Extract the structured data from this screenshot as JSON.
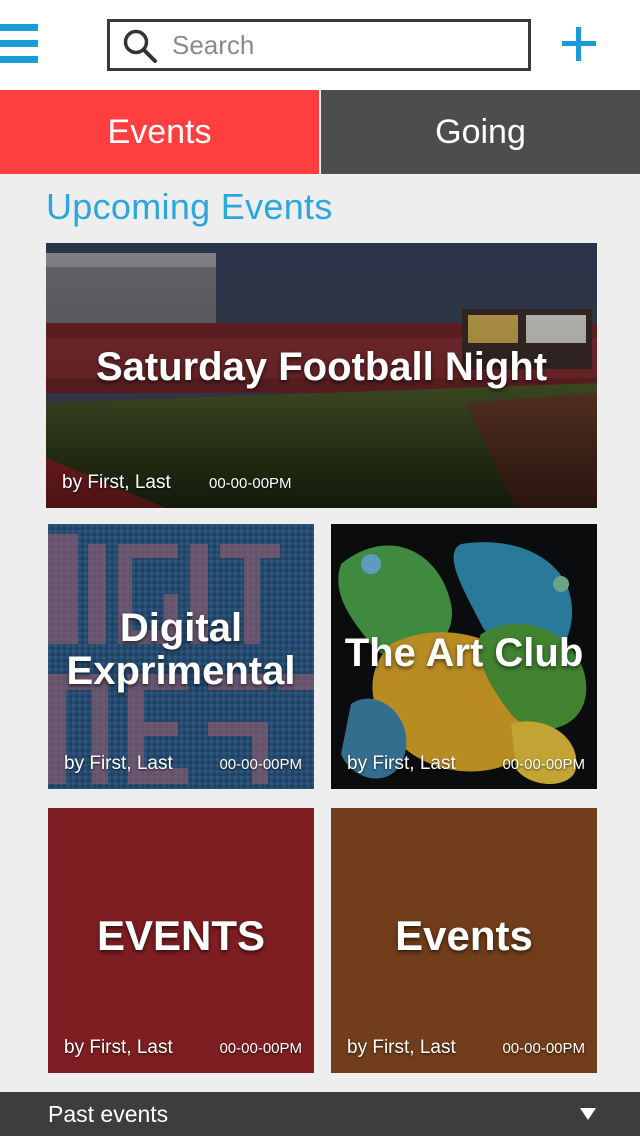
{
  "header": {
    "menu_icon": "hamburger-menu-icon",
    "search_placeholder": "Search",
    "search_value": "",
    "add_icon": "plus-icon",
    "accent_color": "#1a9bd7"
  },
  "tabs": [
    {
      "label": "Events",
      "active": true,
      "color": "#ff3f3f"
    },
    {
      "label": "Going",
      "active": false,
      "color": "#4d4d4d"
    }
  ],
  "section_title": "Upcoming Events",
  "cards": [
    {
      "title": "Saturday Football Night",
      "by": "by First, Last",
      "time": "00-00-00PM",
      "image": "stadium-photo"
    },
    {
      "title": "Digital Exprimental",
      "by": "by First, Last",
      "time": "00-00-00PM",
      "image": "digital-text-pattern"
    },
    {
      "title": "The Art Club",
      "by": "by First, Last",
      "time": "00-00-00PM",
      "image": "colorful-abstract-art"
    },
    {
      "title": "EVENTS",
      "by": "by First, Last",
      "time": "00-00-00PM",
      "color": "#7e1e22"
    },
    {
      "title": "Events",
      "by": "by First, Last",
      "time": "00-00-00PM",
      "color": "#723d1a"
    }
  ],
  "footer": {
    "label": "Past events",
    "arrow_icon": "triangle-down-icon"
  }
}
